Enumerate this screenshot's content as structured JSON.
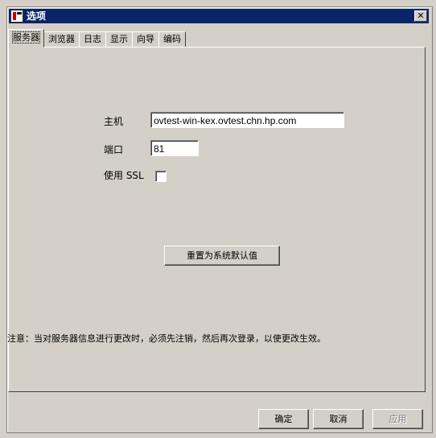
{
  "window": {
    "title": "选项",
    "close_glyph": "✕",
    "icon": "app-icon"
  },
  "tabs": [
    {
      "label": "服务器",
      "active": true
    },
    {
      "label": "浏览器",
      "active": false
    },
    {
      "label": "日志",
      "active": false
    },
    {
      "label": "显示",
      "active": false
    },
    {
      "label": "向导",
      "active": false
    },
    {
      "label": "编码",
      "active": false
    }
  ],
  "server": {
    "host_label": "主机",
    "host_value": "ovtest-win-kex.ovtest.chn.hp.com",
    "port_label": "端口",
    "port_value": "81",
    "ssl_label": "使用 SSL",
    "ssl_checked": false,
    "reset_label": "重置为系统默认值"
  },
  "note": "注意：当对服务器信息进行更改时，必须先注销，然后再次登录，以使更改生效。",
  "footer": {
    "ok_label": "确定",
    "cancel_label": "取消",
    "apply_label": "应用",
    "apply_enabled": false
  }
}
